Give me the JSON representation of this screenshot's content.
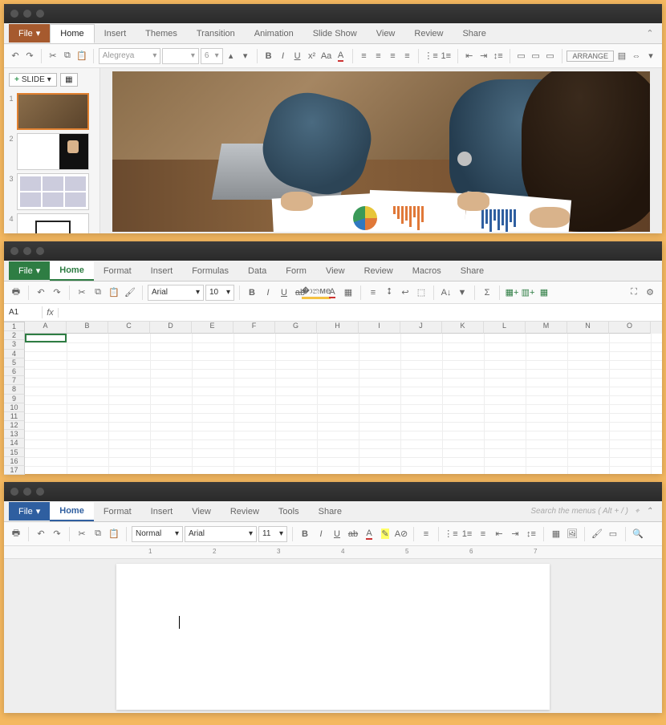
{
  "presentation": {
    "tabs": {
      "file": "File",
      "home": "Home",
      "insert": "Insert",
      "themes": "Themes",
      "transition": "Transition",
      "animation": "Animation",
      "slideshow": "Slide Show",
      "view": "View",
      "review": "Review",
      "share": "Share"
    },
    "font_name": "Alegreya",
    "font_size": "6",
    "add_slide": "SLIDE",
    "arrange_label": "ARRANGE",
    "thumbs": [
      "1",
      "2",
      "3",
      "4"
    ]
  },
  "spreadsheet": {
    "tabs": {
      "file": "File",
      "home": "Home",
      "format": "Format",
      "insert": "Insert",
      "formulas": "Formulas",
      "data": "Data",
      "form": "Form",
      "view": "View",
      "review": "Review",
      "macros": "Macros",
      "share": "Share"
    },
    "font_name": "Arial",
    "font_size": "10",
    "cell_ref": "A1",
    "fx_label": "fx",
    "columns": [
      "A",
      "B",
      "C",
      "D",
      "E",
      "F",
      "G",
      "H",
      "I",
      "J",
      "K",
      "L",
      "M",
      "N",
      "O"
    ],
    "rows": [
      "1",
      "2",
      "3",
      "4",
      "5",
      "6",
      "7",
      "8",
      "9",
      "10",
      "11",
      "12",
      "13",
      "14",
      "15",
      "16",
      "17"
    ]
  },
  "document": {
    "tabs": {
      "file": "File",
      "home": "Home",
      "format": "Format",
      "insert": "Insert",
      "view": "View",
      "review": "Review",
      "tools": "Tools",
      "share": "Share"
    },
    "style": "Normal",
    "font_name": "Arial",
    "font_size": "11",
    "search_placeholder": "Search the menus  ( Alt + / )",
    "ruler_marks": [
      "",
      "1",
      "",
      "2",
      "",
      "3",
      "",
      "4",
      "",
      "5",
      "",
      "6",
      "",
      "7"
    ]
  }
}
